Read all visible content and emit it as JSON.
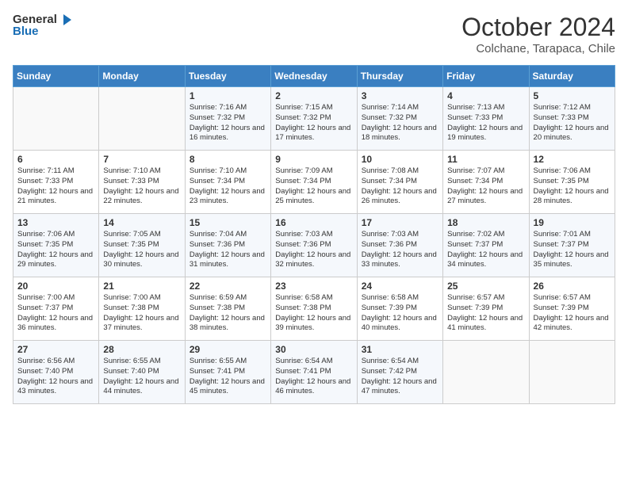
{
  "header": {
    "logo_line1": "General",
    "logo_line2": "Blue",
    "month": "October 2024",
    "location": "Colchane, Tarapaca, Chile"
  },
  "days_of_week": [
    "Sunday",
    "Monday",
    "Tuesday",
    "Wednesday",
    "Thursday",
    "Friday",
    "Saturday"
  ],
  "weeks": [
    [
      {
        "day": "",
        "info": ""
      },
      {
        "day": "",
        "info": ""
      },
      {
        "day": "1",
        "info": "Sunrise: 7:16 AM\nSunset: 7:32 PM\nDaylight: 12 hours and 16 minutes."
      },
      {
        "day": "2",
        "info": "Sunrise: 7:15 AM\nSunset: 7:32 PM\nDaylight: 12 hours and 17 minutes."
      },
      {
        "day": "3",
        "info": "Sunrise: 7:14 AM\nSunset: 7:32 PM\nDaylight: 12 hours and 18 minutes."
      },
      {
        "day": "4",
        "info": "Sunrise: 7:13 AM\nSunset: 7:33 PM\nDaylight: 12 hours and 19 minutes."
      },
      {
        "day": "5",
        "info": "Sunrise: 7:12 AM\nSunset: 7:33 PM\nDaylight: 12 hours and 20 minutes."
      }
    ],
    [
      {
        "day": "6",
        "info": "Sunrise: 7:11 AM\nSunset: 7:33 PM\nDaylight: 12 hours and 21 minutes."
      },
      {
        "day": "7",
        "info": "Sunrise: 7:10 AM\nSunset: 7:33 PM\nDaylight: 12 hours and 22 minutes."
      },
      {
        "day": "8",
        "info": "Sunrise: 7:10 AM\nSunset: 7:34 PM\nDaylight: 12 hours and 23 minutes."
      },
      {
        "day": "9",
        "info": "Sunrise: 7:09 AM\nSunset: 7:34 PM\nDaylight: 12 hours and 25 minutes."
      },
      {
        "day": "10",
        "info": "Sunrise: 7:08 AM\nSunset: 7:34 PM\nDaylight: 12 hours and 26 minutes."
      },
      {
        "day": "11",
        "info": "Sunrise: 7:07 AM\nSunset: 7:34 PM\nDaylight: 12 hours and 27 minutes."
      },
      {
        "day": "12",
        "info": "Sunrise: 7:06 AM\nSunset: 7:35 PM\nDaylight: 12 hours and 28 minutes."
      }
    ],
    [
      {
        "day": "13",
        "info": "Sunrise: 7:06 AM\nSunset: 7:35 PM\nDaylight: 12 hours and 29 minutes."
      },
      {
        "day": "14",
        "info": "Sunrise: 7:05 AM\nSunset: 7:35 PM\nDaylight: 12 hours and 30 minutes."
      },
      {
        "day": "15",
        "info": "Sunrise: 7:04 AM\nSunset: 7:36 PM\nDaylight: 12 hours and 31 minutes."
      },
      {
        "day": "16",
        "info": "Sunrise: 7:03 AM\nSunset: 7:36 PM\nDaylight: 12 hours and 32 minutes."
      },
      {
        "day": "17",
        "info": "Sunrise: 7:03 AM\nSunset: 7:36 PM\nDaylight: 12 hours and 33 minutes."
      },
      {
        "day": "18",
        "info": "Sunrise: 7:02 AM\nSunset: 7:37 PM\nDaylight: 12 hours and 34 minutes."
      },
      {
        "day": "19",
        "info": "Sunrise: 7:01 AM\nSunset: 7:37 PM\nDaylight: 12 hours and 35 minutes."
      }
    ],
    [
      {
        "day": "20",
        "info": "Sunrise: 7:00 AM\nSunset: 7:37 PM\nDaylight: 12 hours and 36 minutes."
      },
      {
        "day": "21",
        "info": "Sunrise: 7:00 AM\nSunset: 7:38 PM\nDaylight: 12 hours and 37 minutes."
      },
      {
        "day": "22",
        "info": "Sunrise: 6:59 AM\nSunset: 7:38 PM\nDaylight: 12 hours and 38 minutes."
      },
      {
        "day": "23",
        "info": "Sunrise: 6:58 AM\nSunset: 7:38 PM\nDaylight: 12 hours and 39 minutes."
      },
      {
        "day": "24",
        "info": "Sunrise: 6:58 AM\nSunset: 7:39 PM\nDaylight: 12 hours and 40 minutes."
      },
      {
        "day": "25",
        "info": "Sunrise: 6:57 AM\nSunset: 7:39 PM\nDaylight: 12 hours and 41 minutes."
      },
      {
        "day": "26",
        "info": "Sunrise: 6:57 AM\nSunset: 7:39 PM\nDaylight: 12 hours and 42 minutes."
      }
    ],
    [
      {
        "day": "27",
        "info": "Sunrise: 6:56 AM\nSunset: 7:40 PM\nDaylight: 12 hours and 43 minutes."
      },
      {
        "day": "28",
        "info": "Sunrise: 6:55 AM\nSunset: 7:40 PM\nDaylight: 12 hours and 44 minutes."
      },
      {
        "day": "29",
        "info": "Sunrise: 6:55 AM\nSunset: 7:41 PM\nDaylight: 12 hours and 45 minutes."
      },
      {
        "day": "30",
        "info": "Sunrise: 6:54 AM\nSunset: 7:41 PM\nDaylight: 12 hours and 46 minutes."
      },
      {
        "day": "31",
        "info": "Sunrise: 6:54 AM\nSunset: 7:42 PM\nDaylight: 12 hours and 47 minutes."
      },
      {
        "day": "",
        "info": ""
      },
      {
        "day": "",
        "info": ""
      }
    ]
  ]
}
